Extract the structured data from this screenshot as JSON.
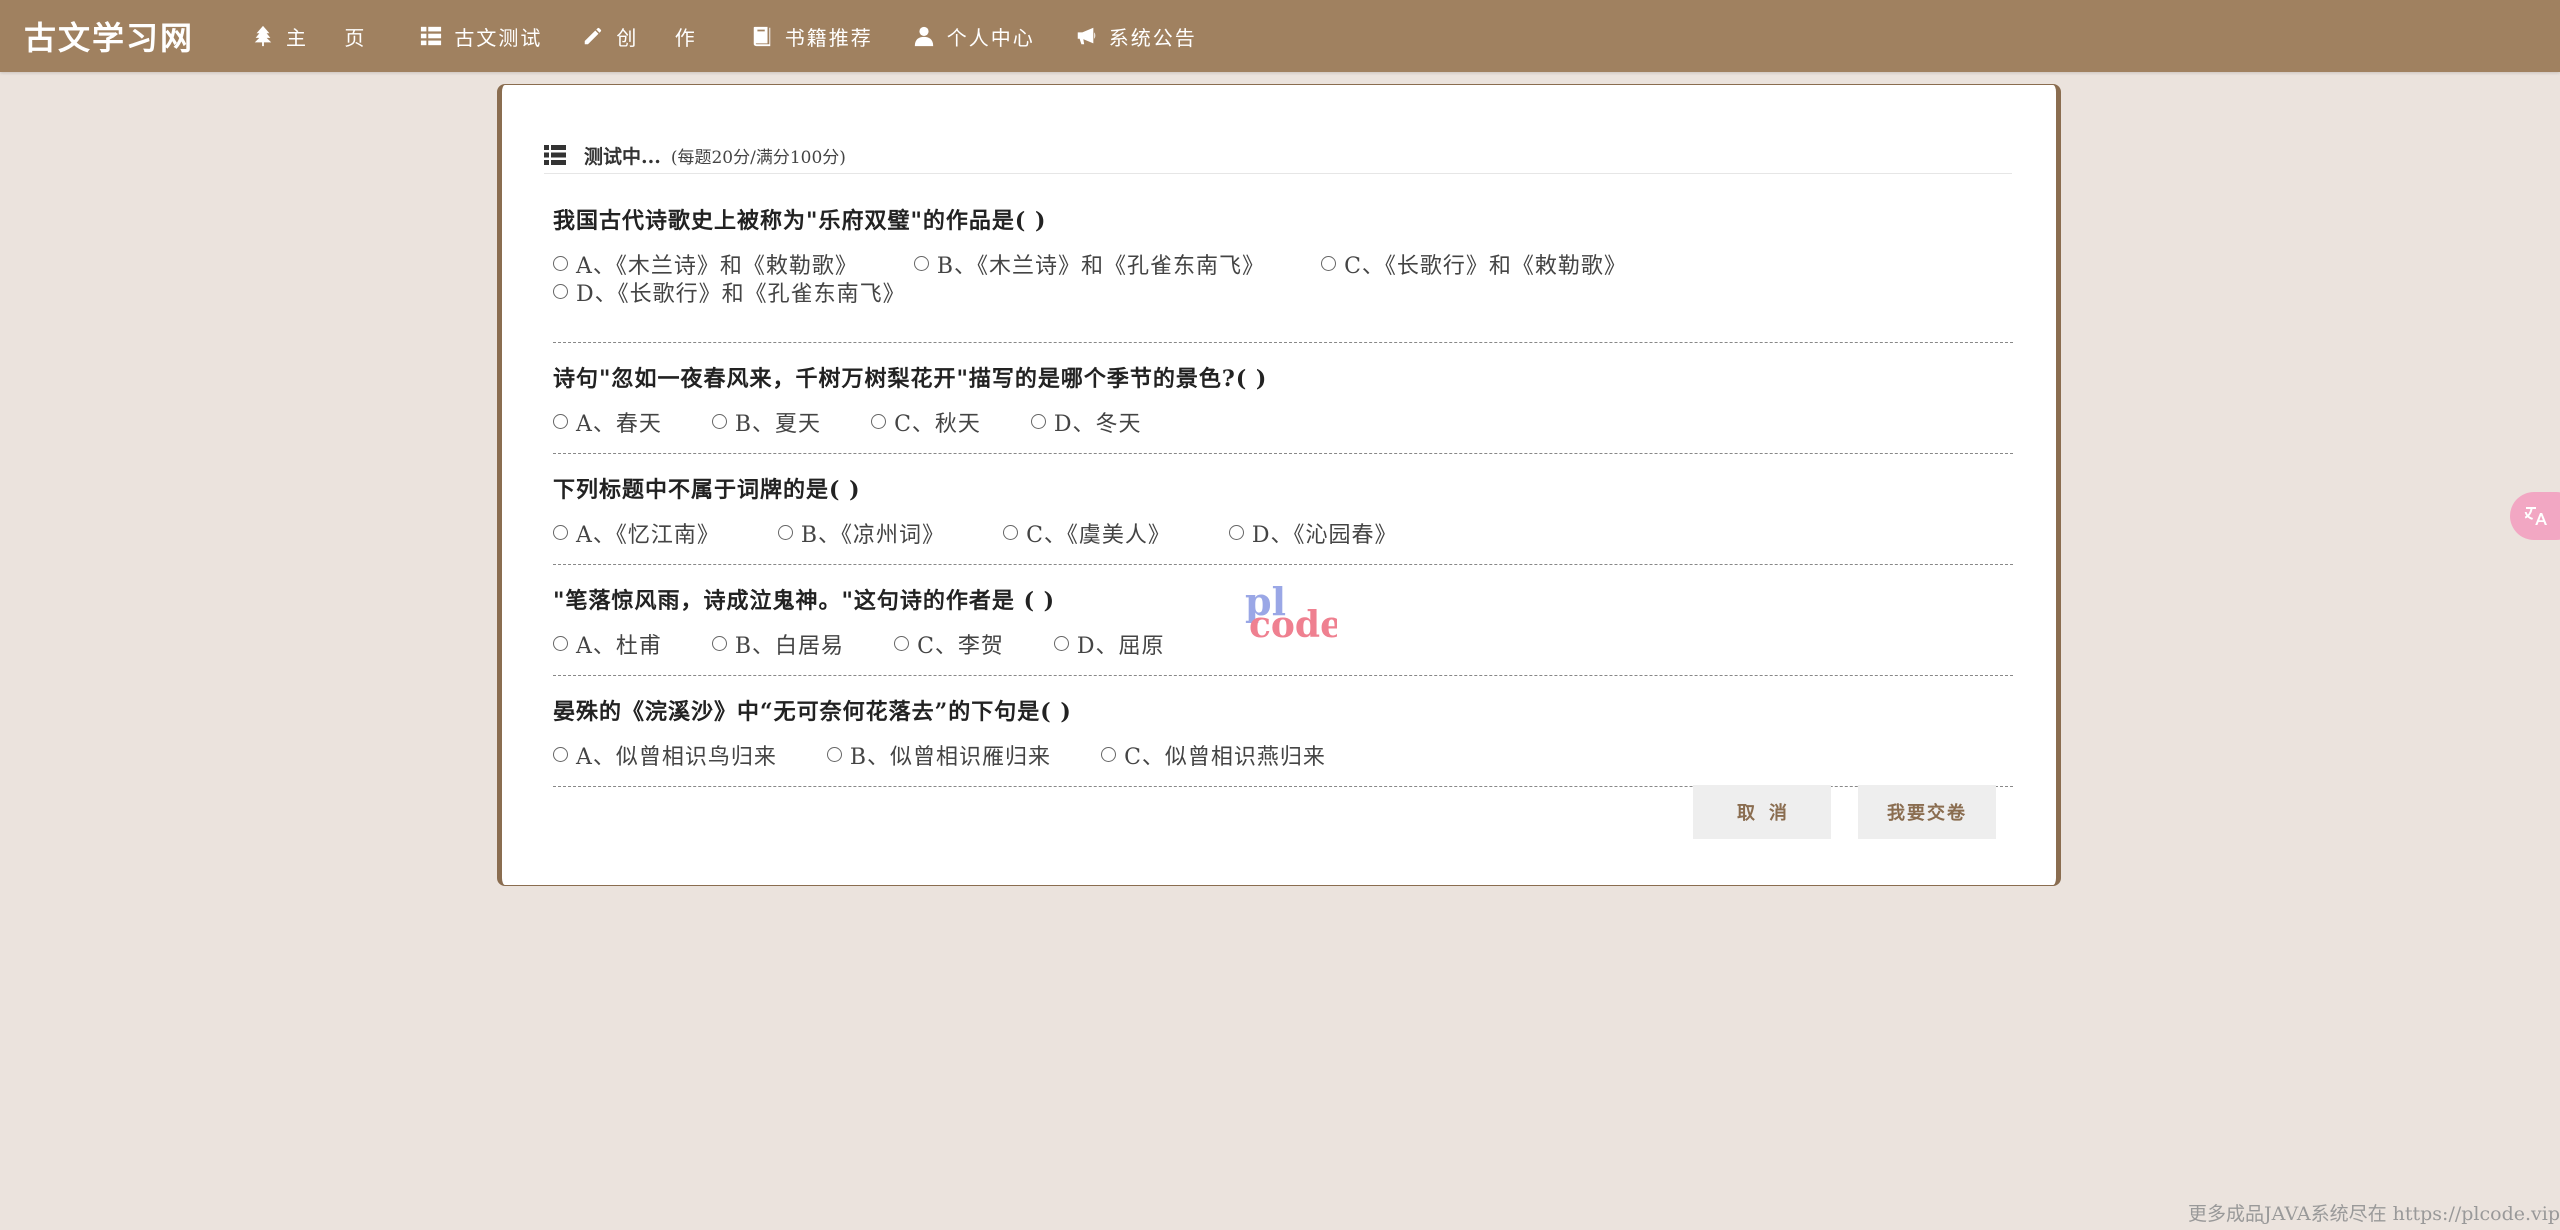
{
  "nav": {
    "brand": "古文学习网",
    "items": [
      {
        "label": "主 页",
        "icon": "tree-icon"
      },
      {
        "label": "古文测试",
        "icon": "list-icon"
      },
      {
        "label": "创 作",
        "icon": "pencil-icon"
      },
      {
        "label": "书籍推荐",
        "icon": "book-icon"
      },
      {
        "label": "个人中心",
        "icon": "user-icon"
      },
      {
        "label": "系统公告",
        "icon": "bullhorn-icon"
      }
    ]
  },
  "quiz": {
    "header_title": "测试中...",
    "header_sub": "(每题20分/满分100分)",
    "questions": [
      {
        "text": "我国古代诗歌史上被称为\"乐府双璧\"的作品是( )",
        "options": [
          "A、《木兰诗》和《敕勒歌》",
          "B、《木兰诗》和《孔雀东南飞》",
          "C、《长歌行》和《敕勒歌》",
          "D、《长歌行》和《孔雀东南飞》"
        ]
      },
      {
        "text": "诗句\"忽如一夜春风来，千树万树梨花开\"描写的是哪个季节的景色?( )",
        "options": [
          "A、春天",
          "B、夏天",
          "C、秋天",
          "D、冬天"
        ]
      },
      {
        "text": "下列标题中不属于词牌的是( )",
        "options": [
          "A、《忆江南》",
          "B、《凉州词》",
          "C、《虞美人》",
          "D、《沁园春》"
        ]
      },
      {
        "text": "\"笔落惊风雨，诗成泣鬼神。\"这句诗的作者是 ( )",
        "options": [
          "A、杜甫",
          "B、白居易",
          "C、李贺",
          "D、屈原"
        ]
      },
      {
        "text": "晏殊的《浣溪沙》中“无可奈何花落去”的下句是( )",
        "options": [
          "A、似曾相识鸟归来",
          "B、似曾相识雁归来",
          "C、似曾相识燕归来"
        ]
      }
    ],
    "cancel_label": "取消",
    "submit_label": "我要交卷"
  },
  "watermark": {
    "line1": "pl",
    "line2": "code"
  },
  "footer_note": "更多成品JAVA系统尽在 https://plcode.vip",
  "colors": {
    "nav_bg": "#a08160",
    "page_bg": "#ebe3dd",
    "accent": "#8a6d50"
  }
}
